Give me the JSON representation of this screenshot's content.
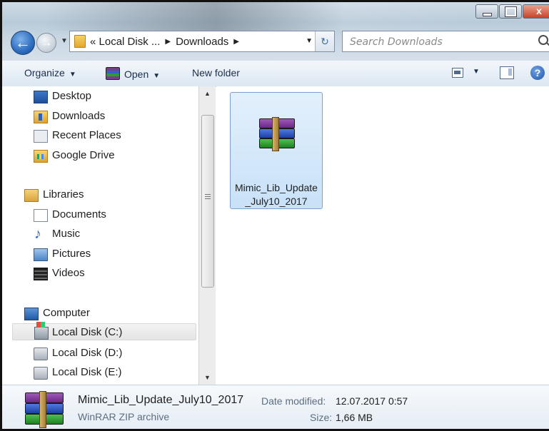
{
  "address": {
    "crumbs": [
      "« Local Disk ...",
      "Downloads"
    ]
  },
  "search": {
    "placeholder": "Search Downloads"
  },
  "toolbar": {
    "organize_label": "Organize",
    "open_label": "Open",
    "new_folder_label": "New folder"
  },
  "window": {
    "close_glyph": "x"
  },
  "sidebar": {
    "favorites": [
      "Desktop",
      "Downloads",
      "Recent Places",
      "Google Drive"
    ],
    "libraries_header": "Libraries",
    "libraries": [
      "Documents",
      "Music",
      "Pictures",
      "Videos"
    ],
    "computer_header": "Computer",
    "drives": [
      "Local Disk (C:)",
      "Local Disk (D:)",
      "Local Disk (E:)"
    ],
    "selected": "Local Disk (C:)"
  },
  "content": {
    "files": [
      {
        "name": "Mimic_Lib_Update_July10_2017",
        "icon": "winrar-archive-icon"
      }
    ]
  },
  "details": {
    "name": "Mimic_Lib_Update_July10_2017",
    "type": "WinRAR ZIP archive",
    "date_modified_label": "Date modified:",
    "date_modified": "12.07.2017 0:57",
    "size_label": "Size:",
    "size": "1,66 MB"
  },
  "icons": {
    "back": "back-arrow-icon",
    "forward": "forward-arrow-icon",
    "refresh": "refresh-icon",
    "search": "search-icon",
    "help": "help-icon"
  }
}
